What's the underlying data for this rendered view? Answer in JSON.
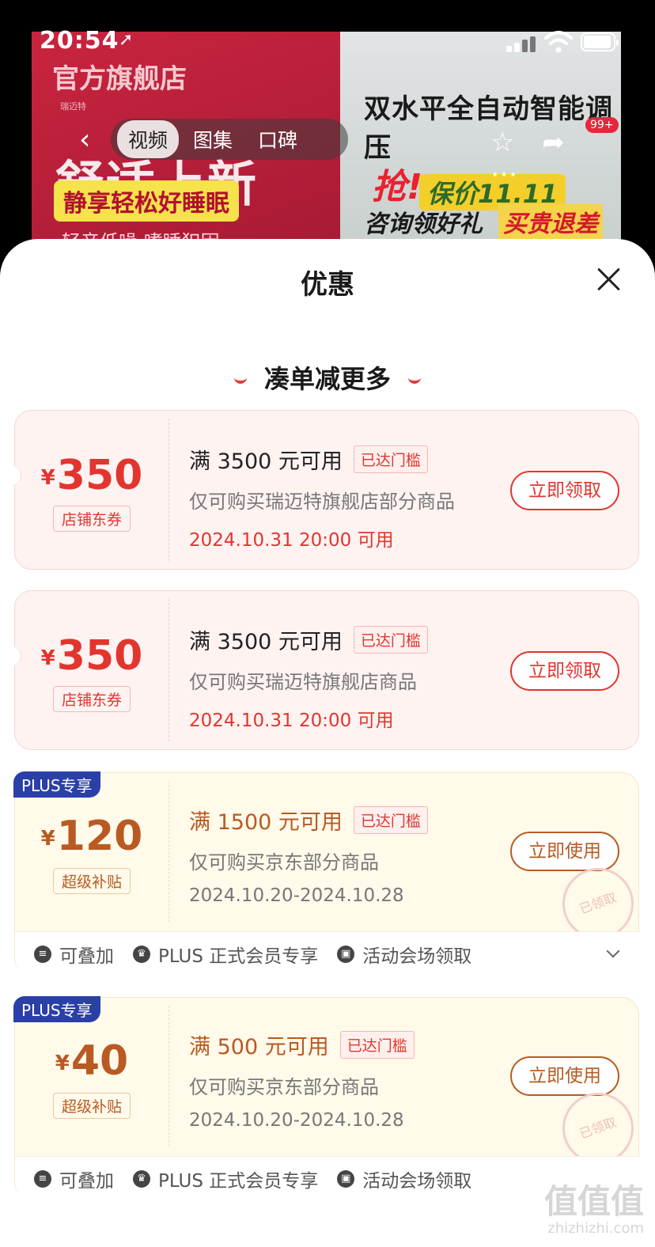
{
  "status": {
    "time": "20:54",
    "location_arrow": "➚"
  },
  "banner": {
    "brand": "官方旗舰店",
    "brand_small": "瑞迈特",
    "headline": "舒适上新",
    "pill": "静享轻松好睡眠",
    "sub": "轻音低噪 嗜睡犯困",
    "promo_title": "双水平全自动智能调压",
    "promo_main": "抢!",
    "promo_tag": "保价11.11",
    "promo_sub": "咨询领好礼",
    "promo_sub2": "买贵退差",
    "badge": "99+"
  },
  "media_tabs": [
    "视频",
    "图集",
    "口碑"
  ],
  "sheet": {
    "title": "优惠",
    "section_title": "凑单减更多"
  },
  "coupons": [
    {
      "currency": "¥",
      "amount": "350",
      "type": "店铺东券",
      "condition": "满 3500 元可用",
      "reached": "已达门槛",
      "scope": "仅可购买瑞迈特旗舰店部分商品",
      "date": "2024.10.31 20:00 可用",
      "button": "立即领取"
    },
    {
      "currency": "¥",
      "amount": "350",
      "type": "店铺东券",
      "condition": "满 3500 元可用",
      "reached": "已达门槛",
      "scope": "仅可购买瑞迈特旗舰店商品",
      "date": "2024.10.31 20:00 可用",
      "button": "立即领取"
    },
    {
      "plus": "PLUS专享",
      "currency": "¥",
      "amount": "120",
      "type": "超级补贴",
      "condition": "满 1500 元可用",
      "reached": "已达门槛",
      "scope": "仅可购买京东部分商品",
      "date": "2024.10.20-2024.10.28",
      "button": "立即使用",
      "stamp": "已领取",
      "footer": [
        "可叠加",
        "PLUS 正式会员专享",
        "活动会场领取"
      ]
    },
    {
      "plus": "PLUS专享",
      "currency": "¥",
      "amount": "40",
      "type": "超级补贴",
      "condition": "满 500 元可用",
      "reached": "已达门槛",
      "scope": "仅可购买京东部分商品",
      "date": "2024.10.20-2024.10.28",
      "button": "立即使用",
      "stamp": "已领取",
      "footer": [
        "可叠加",
        "PLUS 正式会员专享",
        "活动会场领取"
      ]
    }
  ],
  "watermark": {
    "main": "值值值",
    "sub": "zhizhizhi.com"
  },
  "colors": {
    "red": "#e2352e",
    "gold": "#b85a22",
    "plus_blue": "#2b3fa8"
  }
}
